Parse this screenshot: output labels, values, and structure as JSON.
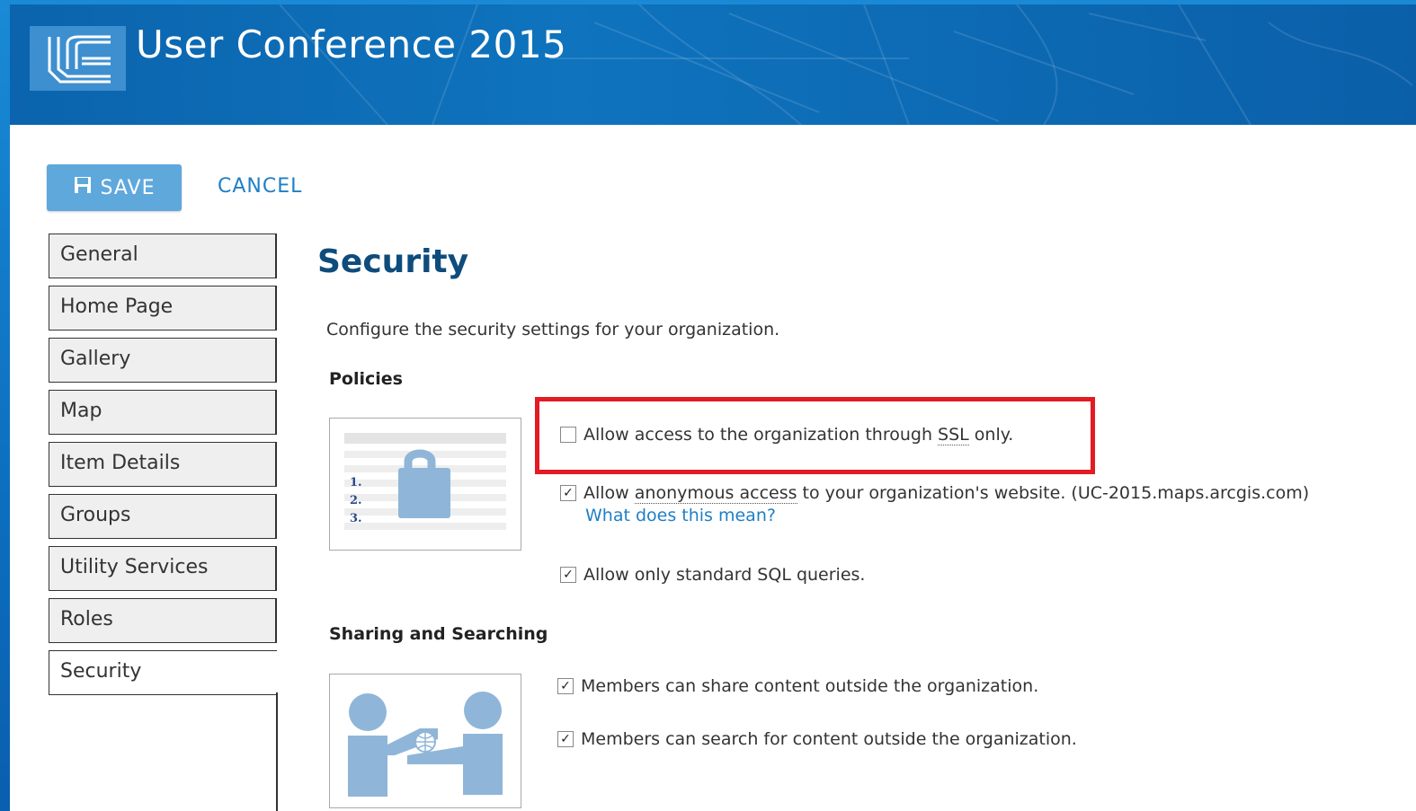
{
  "banner": {
    "title": "User Conference 2015"
  },
  "toolbar": {
    "save_label": "SAVE",
    "cancel_label": "CANCEL"
  },
  "tabs": [
    {
      "label": "General"
    },
    {
      "label": "Home Page"
    },
    {
      "label": "Gallery"
    },
    {
      "label": "Map"
    },
    {
      "label": "Item Details"
    },
    {
      "label": "Groups"
    },
    {
      "label": "Utility Services"
    },
    {
      "label": "Roles"
    },
    {
      "label": "Security",
      "active": true
    }
  ],
  "main": {
    "title": "Security",
    "description": "Configure the security settings for your organization.",
    "policies": {
      "heading": "Policies",
      "ssl": {
        "checked": false,
        "pre": "Allow access to the organization through ",
        "term": "SSL",
        "post": " only."
      },
      "anonymous": {
        "checked": true,
        "pre": "Allow ",
        "term": "anonymous access",
        "post": " to your organization's website. (UC-2015.maps.arcgis.com)",
        "help": "What does this mean?"
      },
      "sql": {
        "checked": true,
        "label": "Allow only standard SQL queries."
      }
    },
    "sharing": {
      "heading": "Sharing and Searching",
      "share": {
        "checked": true,
        "label": "Members can share content outside the organization."
      },
      "search": {
        "checked": true,
        "label": "Members can search for content outside the organization."
      }
    }
  },
  "icons": {
    "logo": "uc-logo-icon",
    "save": "floppy-disk-icon",
    "policy_illustration": "lock-document-icon",
    "sharing_illustration": "people-sharing-icon",
    "checkmark": "✓"
  },
  "colors": {
    "banner": "#0b64ad",
    "accent": "#1f7fc6",
    "save_button": "#5fa8dc",
    "title": "#0e4c7c",
    "highlight": "#e31b23"
  },
  "policy_list_numbers": [
    "1.",
    "2.",
    "3."
  ]
}
